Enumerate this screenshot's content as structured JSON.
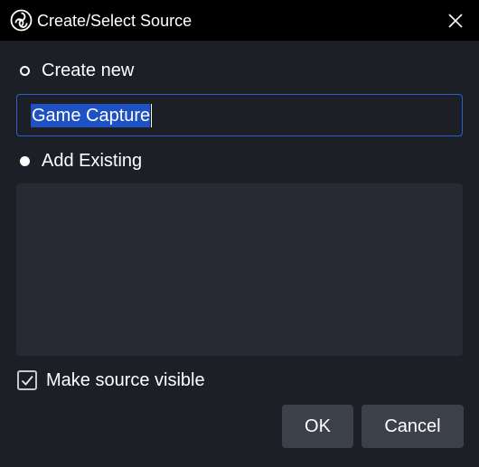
{
  "window": {
    "title": "Create/Select Source",
    "logo_icon": "obs-logo-icon",
    "close_icon": "close-icon"
  },
  "create_new": {
    "label": "Create new",
    "selected": false,
    "name_value": "Game Capture"
  },
  "add_existing": {
    "label": "Add Existing",
    "selected": true,
    "items": []
  },
  "visibility": {
    "label": "Make source visible",
    "checked": true
  },
  "buttons": {
    "ok_label": "OK",
    "cancel_label": "Cancel"
  },
  "colors": {
    "background": "#1d1f26",
    "titlebar": "#000000",
    "list_background": "#272a33",
    "button": "#3c404b",
    "input_border": "#2a5fd0",
    "selection": "#1e52c4"
  }
}
